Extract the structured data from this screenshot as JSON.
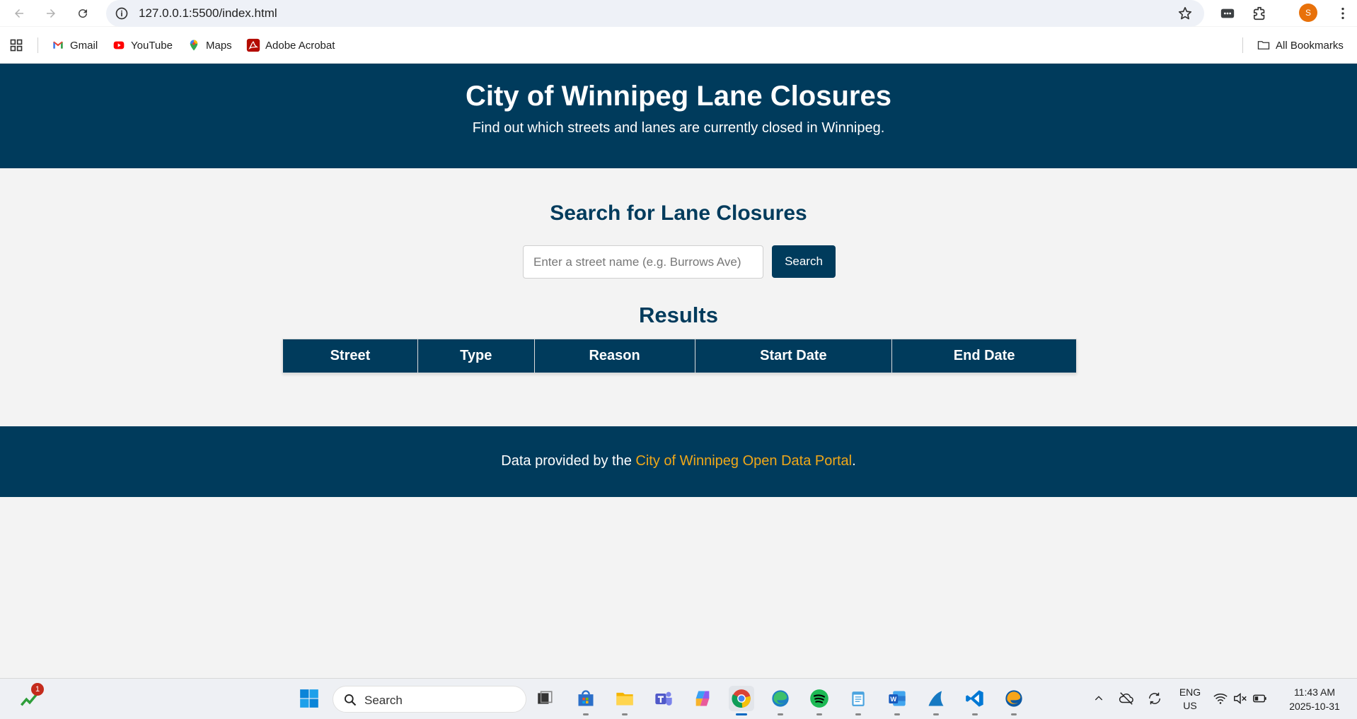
{
  "browser": {
    "url": "127.0.0.1:5500/index.html",
    "profile_initial": "S",
    "bookmarks": [
      {
        "label": "Gmail",
        "icon": "gmail-icon"
      },
      {
        "label": "YouTube",
        "icon": "youtube-icon"
      },
      {
        "label": "Maps",
        "icon": "maps-icon"
      },
      {
        "label": "Adobe Acrobat",
        "icon": "acrobat-icon"
      }
    ],
    "all_bookmarks_label": "All Bookmarks"
  },
  "header": {
    "title": "City of Winnipeg Lane Closures",
    "subtitle": "Find out which streets and lanes are currently closed in Winnipeg."
  },
  "search": {
    "heading": "Search for Lane Closures",
    "placeholder": "Enter a street name (e.g. Burrows Ave)",
    "value": "",
    "button_label": "Search"
  },
  "results": {
    "heading": "Results",
    "columns": [
      "Street",
      "Type",
      "Reason",
      "Start Date",
      "End Date"
    ],
    "rows": []
  },
  "footer": {
    "prefix": "Data provided by the ",
    "link_text": "City of Winnipeg Open Data Portal",
    "suffix": "."
  },
  "taskbar": {
    "search_label": "Search",
    "notification_count": "1",
    "lang_primary": "ENG",
    "lang_secondary": "US",
    "time": "11:43 AM",
    "date": "2025-10-31"
  },
  "colors": {
    "brand": "#003b5c",
    "link": "#f0a818",
    "page_bg": "#f3f3f3"
  }
}
